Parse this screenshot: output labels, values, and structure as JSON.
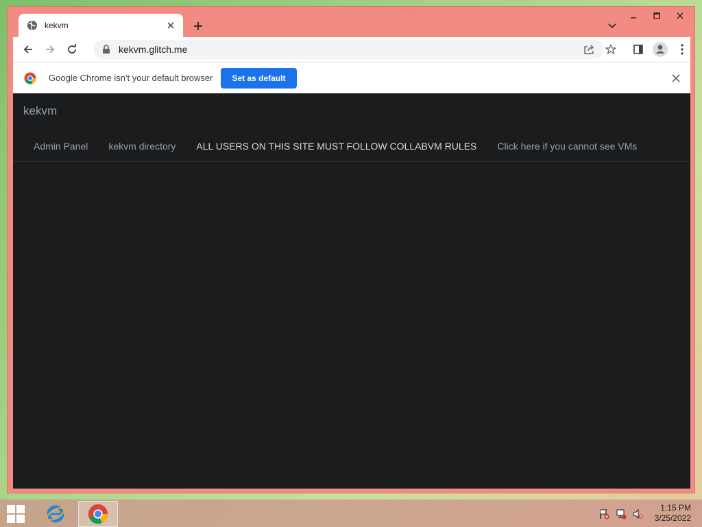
{
  "browser": {
    "tab": {
      "title": "kekvm",
      "favicon": "globe-icon"
    },
    "address": {
      "url": "kekvm.glitch.me"
    },
    "infobar": {
      "message": "Google Chrome isn't your default browser",
      "button_label": "Set as default"
    }
  },
  "page": {
    "brand": "kekvm",
    "nav": [
      {
        "label": "Admin Panel"
      },
      {
        "label": "kekvm directory"
      },
      {
        "label": "ALL USERS ON THIS SITE MUST FOLLOW COLLABVM RULES"
      },
      {
        "label": "Click here if you cannot see VMs"
      }
    ]
  },
  "taskbar": {
    "time": "1:15 PM",
    "date": "3/25/2022",
    "pinned": [
      "internet-explorer-icon",
      "chrome-icon"
    ],
    "tray_icons": [
      "action-center-flag-icon",
      "network-icon",
      "volume-muted-icon"
    ]
  },
  "colors": {
    "window_frame": "#f28b82",
    "page_bg": "#1b1c1e",
    "accent": "#1a73e8"
  }
}
